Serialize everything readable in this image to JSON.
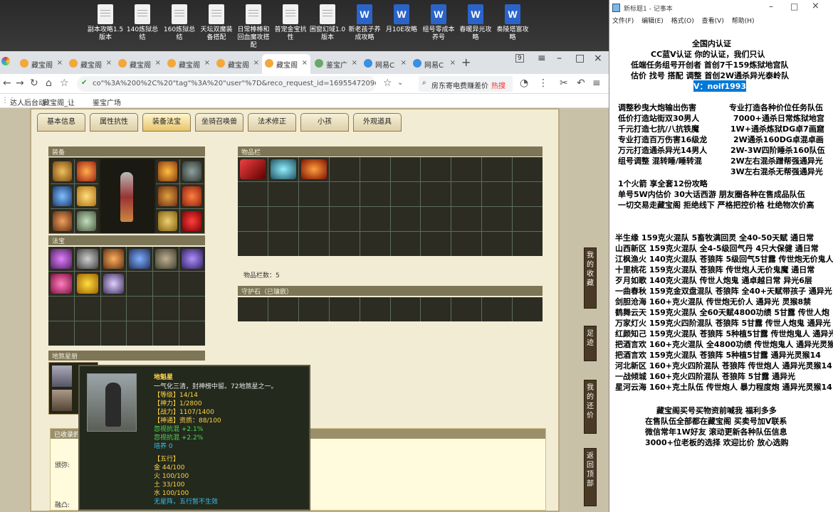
{
  "desktop": {
    "icons": [
      "副本攻略1.5版本",
      "140炼狱总结",
      "160炼狱总结",
      "天坛双魔装备搭配",
      "日常棒棒和回血魔攻搭配",
      "普宠金宝抗性",
      "困窗幻域1.0版本",
      "新老孩子养成攻略",
      "月10E攻略",
      "组号零成本养号",
      "春暖异光攻略",
      "奏陵塔富攻略"
    ]
  },
  "browser": {
    "tabs": [
      "藏宝阁",
      "藏宝阁",
      "藏宝阁",
      "藏宝阁",
      "藏宝阁",
      "藏宝阁",
      "鉴宝广",
      "网易C",
      "网易C"
    ],
    "active_tab": "藏宝阁",
    "tab_badge": "9",
    "address": "co\"%3A%200%2C%20\"tag\"%3A%20\"user\"%7D&reco_request_id=1695547209079wkxbj",
    "search_text": "房东寄电费赚差价",
    "search_hot": "热搜",
    "bookmarks": [
      "达人后台动",
      "藏宝阁_让",
      "鉴宝广场"
    ]
  },
  "game": {
    "tabs": [
      "基本信息",
      "属性抗性",
      "装备法宝",
      "坐骑召唤兽",
      "法术修正",
      "小孩",
      "外观道具"
    ],
    "active_tab": "装备法宝",
    "equip_title": "装备",
    "fabao_title": "法宝",
    "inventory_title": "物品栏",
    "item_count": "物品栏数：5",
    "guardian_title": "守护石（已镶嵌）",
    "disha_title": "地煞星册",
    "collected_title": "已收录的",
    "side_buttons": [
      "我的收藏",
      "足迹",
      "我的还价",
      "返回顶部"
    ],
    "collect_labels": [
      "颁弥:",
      "融凸:"
    ]
  },
  "tooltip": {
    "name": "地魁星",
    "desc": "一气化三清，封神榜中留。72地煞星之一。",
    "grade": "【等级】14/14",
    "shen": "【神力】1/2800",
    "zhan": "【战力】1107/1400",
    "tong": "【神通】资质：88/100",
    "resist1": "忽视抗混 +2.1%",
    "resist2": "忽视抗混 +2.2%",
    "train": "培养 0",
    "wx_title": "【五行】",
    "wx": [
      "金 44/100",
      "火 100/100",
      "土 33/100",
      "水 100/100"
    ],
    "note": "无星阵，五行暂不生效"
  },
  "notepad": {
    "title": "新标题1 - 记事本",
    "menu": [
      "文件(F)",
      "编辑(E)",
      "格式(O)",
      "查看(V)",
      "帮助(H)"
    ],
    "header": [
      "全国内认证",
      "CC蓝V认证  你的认证，我们只认",
      "低端任务组号开创者        首创7千159炼狱地宫队",
      "估价 找号 搭配 调整       首创2W通杀异光泰岭队"
    ],
    "vline": "V：noif1993",
    "left_col": [
      "调整秒曳大炮输出伤害",
      "低价打造站街双30男人",
      "千元打造七抗/八抗铁魔",
      "专业打造百万伤害16级龙",
      "万元打造通杀异光14男人",
      "组号调整 混转睡/睡转混"
    ],
    "right_col": [
      "专业打造各种价位任务队伍",
      "7000+通杀日常炼狱地宫",
      "1W+通杀炼狱DG卓7画窟",
      "2W通杀160DG卓混卓画",
      "2W-3W四阶睡杀160队伍",
      "2W左右混杀蹭帮强通异光",
      "3W左右混杀无帮强通异光"
    ],
    "mid": [
      "1个火箭 享全套12份攻略",
      "单号5W内估价 30大话西游        朋友圈各种在售成品队伍",
      "一切交易走藏宝阁 拒绝线下     严格把控价格 杜绝物次价高"
    ],
    "list": [
      "半生缘    159克火混队 5畜牧满回灵 全40-50天赋 通日常",
      "山西新区 159克火混队 全4-5级回气丹 4只大保健 通日常",
      "江枫渔火 140克火混队 苍狼阵 5级回气5甘露 传世炮无价鬼人",
      "十里桃花 159克火混队 苍狼阵 传世炮人无价鬼魔 通日常",
      "歹月如歌 140克火混队 传世人炮鬼 通卓越日常 异光6层",
      "一曲春秋 159克金双盘混队 苍狼阵 全40+天赋带孩子 通异光",
      "剑胆沧海 160+克火混队 传世炮无价人 通异光 灵猴8禁",
      "鹤舞云天 159克火混队 全60天赋4800功绩 5甘露 传世人炮",
      "万家灯火  159克火四阶混队 苍狼阵 5甘露 传世人炮鬼 通异光",
      "红颜知己 159克火混队 苍狼阵 5种植5甘露 传世炮鬼人 通异光",
      "把酒言欢 160+克火混队 全4800功绩 传世炮鬼人 通异光灵猴",
      "把酒言欢 159克火混队 苍狼阵 5种植5甘露 通异光灵猴14",
      "河北新区 160+克火四阶混队 苍狼阵 传世炮人 通异光灵猴14",
      "一战倾城 160+克火四阶混队 苍狼阵 5甘露 通异光",
      "星河云海 160+克土队伍 传世炮人 暴力程度炮 通异光灵猴14"
    ],
    "footer": [
      "藏宝阁买号买物资前喊我 福利多多",
      "在售队伍全部都在藏宝阁 买卖号加V联系",
      "微信常年1W好友 滚动更新各种队伍信息",
      "3000+位老板的选择 欢迎比价 放心选购"
    ]
  },
  "colors": {
    "accent": "#0078d7",
    "game_bg": "#f3ecd5",
    "item_bg": "#2c2c22"
  }
}
